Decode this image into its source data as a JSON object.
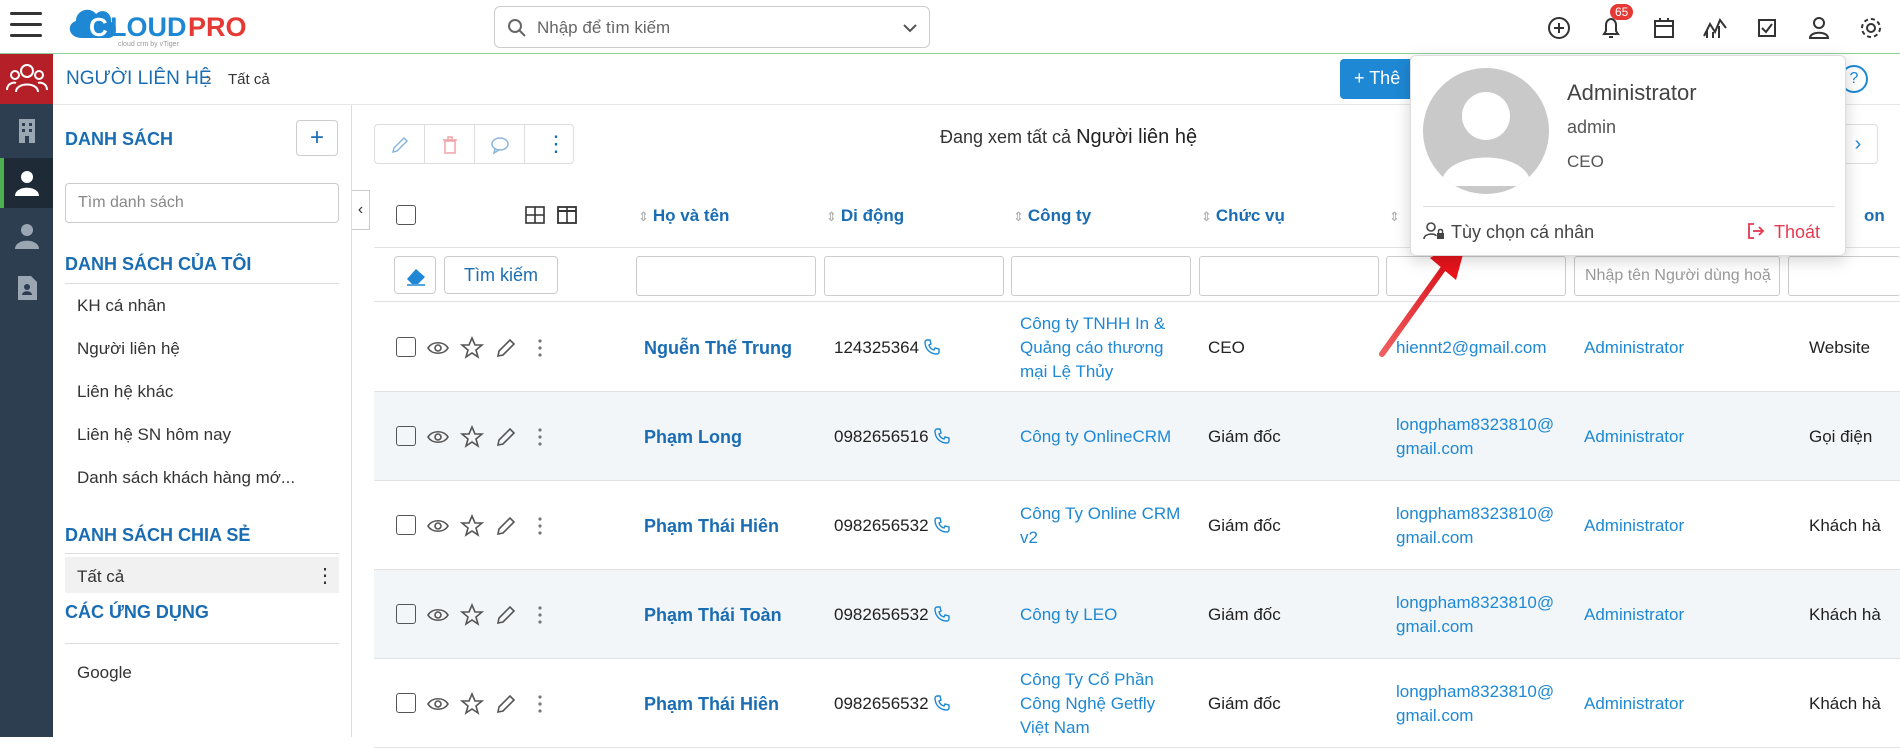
{
  "app": {
    "logo_text": "CLOUDPRO",
    "logo_tagline": "cloud crm by vTiger",
    "search_placeholder": "Nhập để tìm kiếm",
    "notification_count": "65"
  },
  "breadcrumb": {
    "module": "NGƯỜI LIÊN HỆ",
    "current": "Tất cả"
  },
  "sidebar": {
    "list_header": "DANH SÁCH",
    "search_placeholder": "Tìm danh sách",
    "my_lists_header": "DANH SÁCH CỦA TÔI",
    "my_lists": [
      "KH cá nhân",
      "Người liên hệ",
      "Liên hệ khác",
      "Liên hệ SN hôm nay",
      "Danh sách khách hàng mớ..."
    ],
    "shared_header": "DANH SÁCH CHIA SẺ",
    "shared_lists": [
      "Tất cả"
    ],
    "apps_header": "CÁC ỨNG DỤNG",
    "apps": [
      "Google"
    ]
  },
  "main": {
    "viewing_prefix": "Đang xem tất cả",
    "viewing_module": "Người liên hệ",
    "add_button": "+ Thê",
    "columns": [
      "Họ và tên",
      "Di động",
      "Công ty",
      "Chức vụ",
      "",
      "",
      "on"
    ],
    "find_button": "Tìm kiếm",
    "assignee_filter_placeholder": "Nhập tên Người dùng hoặ",
    "rows": [
      {
        "name": "Nguễn Thế Trung",
        "mobile": "124325364",
        "company": [
          "Công ty TNHH In &",
          "Quảng cáo thương",
          "mại Lệ Thủy"
        ],
        "title": "CEO",
        "email": [
          "hiennt2@gmail.com"
        ],
        "assignee": "Administrator",
        "source": "Website"
      },
      {
        "name": "Phạm Long",
        "mobile": "0982656516",
        "company": [
          "Công ty OnlineCRM"
        ],
        "title": "Giám đốc",
        "email": [
          "longpham8323810@",
          "gmail.com"
        ],
        "assignee": "Administrator",
        "source": "Gọi điện"
      },
      {
        "name": "Phạm Thái Hiên",
        "mobile": "0982656532",
        "company": [
          "Công Ty Online CRM",
          "v2"
        ],
        "title": "Giám đốc",
        "email": [
          "longpham8323810@",
          "gmail.com"
        ],
        "assignee": "Administrator",
        "source": "Khách hà"
      },
      {
        "name": "Phạm Thái Toàn",
        "mobile": "0982656532",
        "company": [
          "Công ty LEO"
        ],
        "title": "Giám đốc",
        "email": [
          "longpham8323810@",
          "gmail.com"
        ],
        "assignee": "Administrator",
        "source": "Khách hà"
      },
      {
        "name": "Phạm Thái Hiên",
        "mobile": "0982656532",
        "company": [
          "Công Ty Cổ Phần",
          "Công Nghệ Getfly",
          "Việt Nam"
        ],
        "title": "Giám đốc",
        "email": [
          "longpham8323810@",
          "gmail.com"
        ],
        "assignee": "Administrator",
        "source": "Khách hà"
      }
    ]
  },
  "profile_popup": {
    "name": "Administrator",
    "username": "admin",
    "role": "CEO",
    "options_label": "Tùy chọn cá nhân",
    "logout_label": "Thoát"
  },
  "colors": {
    "brand_blue": "#1a6db3",
    "link_blue": "#1e88d4",
    "rail_dark": "#2c3e50",
    "rail_active_red": "#b52028",
    "logout_red": "#e53950",
    "arrow_red": "#e8141c"
  }
}
